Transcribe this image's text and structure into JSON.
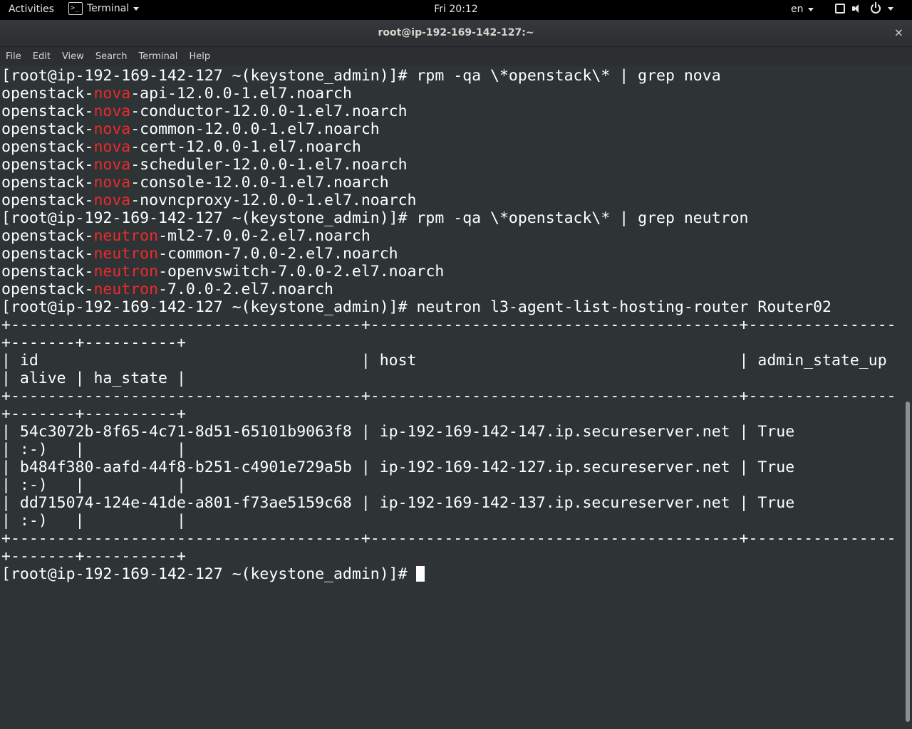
{
  "topbar": {
    "activities": "Activities",
    "app_name": "Terminal",
    "clock": "Fri 20:12",
    "language": "en"
  },
  "window": {
    "title": "root@ip-192-169-142-127:~",
    "close_glyph": "×"
  },
  "menu": {
    "file": "File",
    "edit": "Edit",
    "view": "View",
    "search": "Search",
    "terminal": "Terminal",
    "help": "Help"
  },
  "terminal": {
    "lines": [
      {
        "segments": [
          {
            "t": "[root@ip-192-169-142-127 ~(keystone_admin)]# rpm -qa \\*openstack\\* | grep nova",
            "h": false
          }
        ]
      },
      {
        "segments": [
          {
            "t": "openstack-",
            "h": false
          },
          {
            "t": "nova",
            "h": true
          },
          {
            "t": "-api-12.0.0-1.el7.noarch",
            "h": false
          }
        ]
      },
      {
        "segments": [
          {
            "t": "openstack-",
            "h": false
          },
          {
            "t": "nova",
            "h": true
          },
          {
            "t": "-conductor-12.0.0-1.el7.noarch",
            "h": false
          }
        ]
      },
      {
        "segments": [
          {
            "t": "openstack-",
            "h": false
          },
          {
            "t": "nova",
            "h": true
          },
          {
            "t": "-common-12.0.0-1.el7.noarch",
            "h": false
          }
        ]
      },
      {
        "segments": [
          {
            "t": "openstack-",
            "h": false
          },
          {
            "t": "nova",
            "h": true
          },
          {
            "t": "-cert-12.0.0-1.el7.noarch",
            "h": false
          }
        ]
      },
      {
        "segments": [
          {
            "t": "openstack-",
            "h": false
          },
          {
            "t": "nova",
            "h": true
          },
          {
            "t": "-scheduler-12.0.0-1.el7.noarch",
            "h": false
          }
        ]
      },
      {
        "segments": [
          {
            "t": "openstack-",
            "h": false
          },
          {
            "t": "nova",
            "h": true
          },
          {
            "t": "-console-12.0.0-1.el7.noarch",
            "h": false
          }
        ]
      },
      {
        "segments": [
          {
            "t": "openstack-",
            "h": false
          },
          {
            "t": "nova",
            "h": true
          },
          {
            "t": "-novncproxy-12.0.0-1.el7.noarch",
            "h": false
          }
        ]
      },
      {
        "segments": [
          {
            "t": "[root@ip-192-169-142-127 ~(keystone_admin)]# rpm -qa \\*openstack\\* | grep neutron",
            "h": false
          }
        ]
      },
      {
        "segments": [
          {
            "t": "openstack-",
            "h": false
          },
          {
            "t": "neutron",
            "h": true
          },
          {
            "t": "-ml2-7.0.0-2.el7.noarch",
            "h": false
          }
        ]
      },
      {
        "segments": [
          {
            "t": "openstack-",
            "h": false
          },
          {
            "t": "neutron",
            "h": true
          },
          {
            "t": "-common-7.0.0-2.el7.noarch",
            "h": false
          }
        ]
      },
      {
        "segments": [
          {
            "t": "openstack-",
            "h": false
          },
          {
            "t": "neutron",
            "h": true
          },
          {
            "t": "-openvswitch-7.0.0-2.el7.noarch",
            "h": false
          }
        ]
      },
      {
        "segments": [
          {
            "t": "openstack-",
            "h": false
          },
          {
            "t": "neutron",
            "h": true
          },
          {
            "t": "-7.0.0-2.el7.noarch",
            "h": false
          }
        ]
      },
      {
        "segments": [
          {
            "t": "[root@ip-192-169-142-127 ~(keystone_admin)]# neutron l3-agent-list-hosting-router Router02",
            "h": false
          }
        ]
      },
      {
        "segments": [
          {
            "t": "+--------------------------------------+----------------------------------------+----------------",
            "h": false
          }
        ]
      },
      {
        "segments": [
          {
            "t": "+-------+----------+",
            "h": false
          }
        ]
      },
      {
        "segments": [
          {
            "t": "| id                                   | host                                   | admin_state_up",
            "h": false
          }
        ]
      },
      {
        "segments": [
          {
            "t": "| alive | ha_state |",
            "h": false
          }
        ]
      },
      {
        "segments": [
          {
            "t": "+--------------------------------------+----------------------------------------+----------------",
            "h": false
          }
        ]
      },
      {
        "segments": [
          {
            "t": "+-------+----------+",
            "h": false
          }
        ]
      },
      {
        "segments": [
          {
            "t": "| 54c3072b-8f65-4c71-8d51-65101b9063f8 | ip-192-169-142-147.ip.secureserver.net | True",
            "h": false
          }
        ]
      },
      {
        "segments": [
          {
            "t": "| :-)   |          |",
            "h": false
          }
        ]
      },
      {
        "segments": [
          {
            "t": "| b484f380-aafd-44f8-b251-c4901e729a5b | ip-192-169-142-127.ip.secureserver.net | True",
            "h": false
          }
        ]
      },
      {
        "segments": [
          {
            "t": "| :-)   |          |",
            "h": false
          }
        ]
      },
      {
        "segments": [
          {
            "t": "| dd715074-124e-41de-a801-f73ae5159c68 | ip-192-169-142-137.ip.secureserver.net | True",
            "h": false
          }
        ]
      },
      {
        "segments": [
          {
            "t": "| :-)   |          |",
            "h": false
          }
        ]
      },
      {
        "segments": [
          {
            "t": "+--------------------------------------+----------------------------------------+----------------",
            "h": false
          }
        ]
      },
      {
        "segments": [
          {
            "t": "+-------+----------+",
            "h": false
          }
        ]
      }
    ],
    "prompt": "[root@ip-192-169-142-127 ~(keystone_admin)]# ",
    "highlight_color": "#ef2929",
    "text_color": "#ffffff",
    "background_color": "#2e3436"
  },
  "icons": {
    "app": "terminal-icon",
    "window_switch": "window-square-icon",
    "volume": "speaker-icon",
    "power": "power-icon"
  }
}
